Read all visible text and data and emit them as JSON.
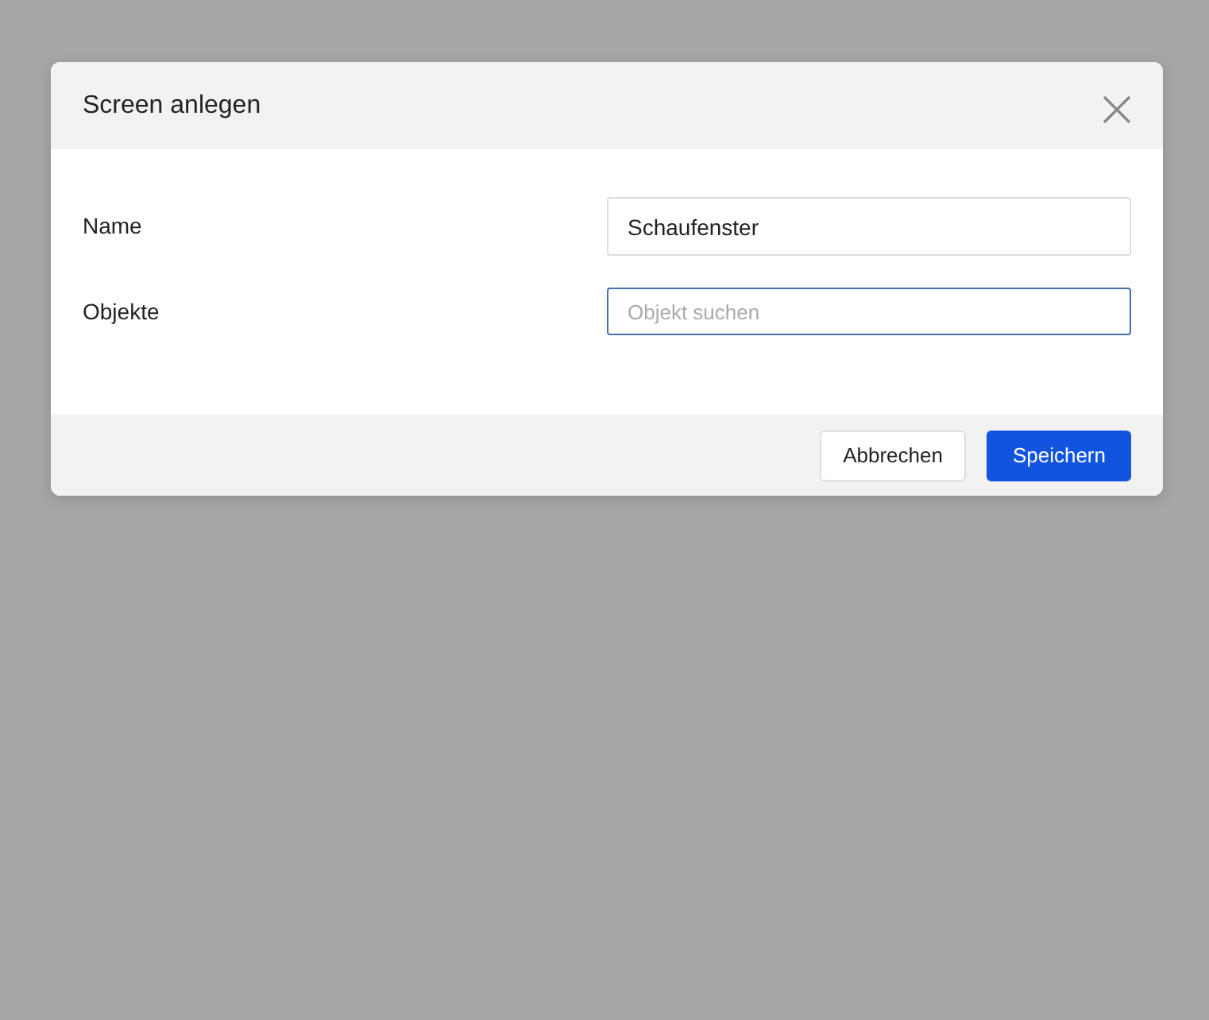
{
  "dialog": {
    "title": "Screen anlegen",
    "fields": [
      {
        "label": "Name",
        "value": "Schaufenster",
        "focused": false
      },
      {
        "label": "Objekte",
        "placeholder": "Objekt suchen",
        "focused": true
      }
    ],
    "buttons": [
      {
        "label": "Abbrechen",
        "kind": "secondary"
      },
      {
        "label": "Speichern",
        "kind": "primary"
      }
    ]
  }
}
